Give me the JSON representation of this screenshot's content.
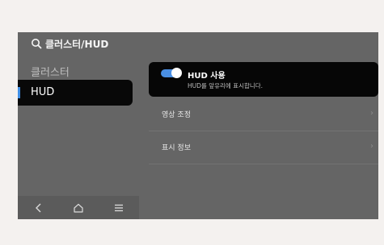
{
  "header": {
    "title": "클러스터/HUD"
  },
  "sidebar": {
    "items": [
      {
        "label": "클러스터"
      },
      {
        "label": "HUD"
      }
    ]
  },
  "hud_setting": {
    "title": "HUD 사용",
    "description": "HUD를 앞유리에 표시합니다.",
    "enabled": true
  },
  "rows": [
    {
      "label": "영상 조정"
    },
    {
      "label": "표시 정보"
    }
  ],
  "icons": {
    "search": "search-icon",
    "back": "back-icon",
    "home": "home-icon",
    "menu": "menu-icon",
    "chevron": "chevron-right-icon"
  },
  "colors": {
    "accent": "#4a8fe4",
    "panel": "#656565",
    "card": "#060606"
  }
}
